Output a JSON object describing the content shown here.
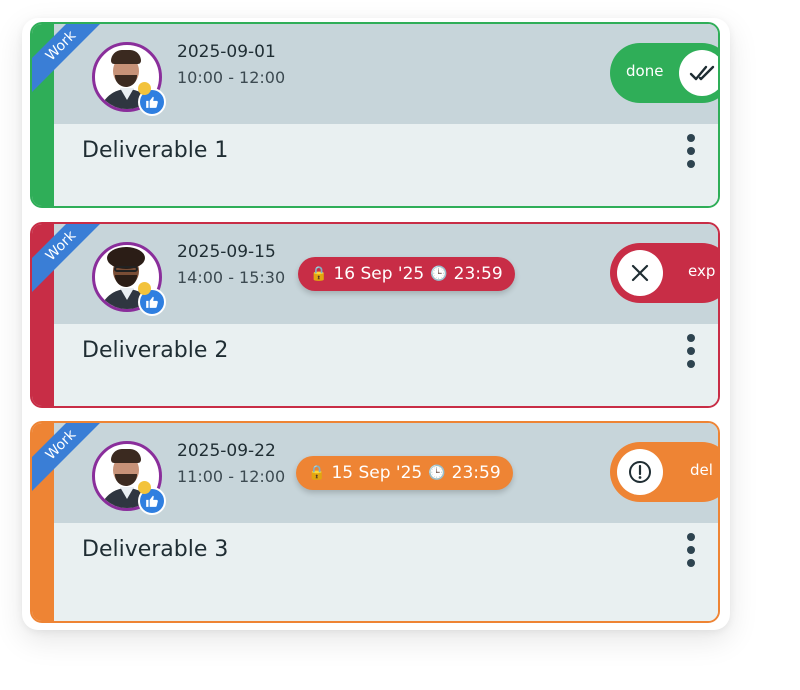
{
  "colors": {
    "done": "#2fae58",
    "expired": "#c82d46",
    "deleted": "#ee8434",
    "ribbon": "#3a7ed6"
  },
  "cards": [
    {
      "tag": "Work",
      "date": "2025-09-01",
      "time": "10:00 - 12:00",
      "toggle_label": "done",
      "toggle_icon": "double-check-icon",
      "title": "Deliverable 1"
    },
    {
      "tag": "Work",
      "date": "2025-09-15",
      "time": "14:00 - 15:30",
      "deadline_date": "16 Sep '25",
      "deadline_time": "23:59",
      "toggle_label": "exp",
      "toggle_icon": "close-icon",
      "title": "Deliverable 2"
    },
    {
      "tag": "Work",
      "date": "2025-09-22",
      "time": "11:00 - 12:00",
      "deadline_date": "15 Sep '25",
      "deadline_time": "23:59",
      "toggle_label": "del",
      "toggle_icon": "exclamation-icon",
      "title": "Deliverable 3"
    }
  ]
}
